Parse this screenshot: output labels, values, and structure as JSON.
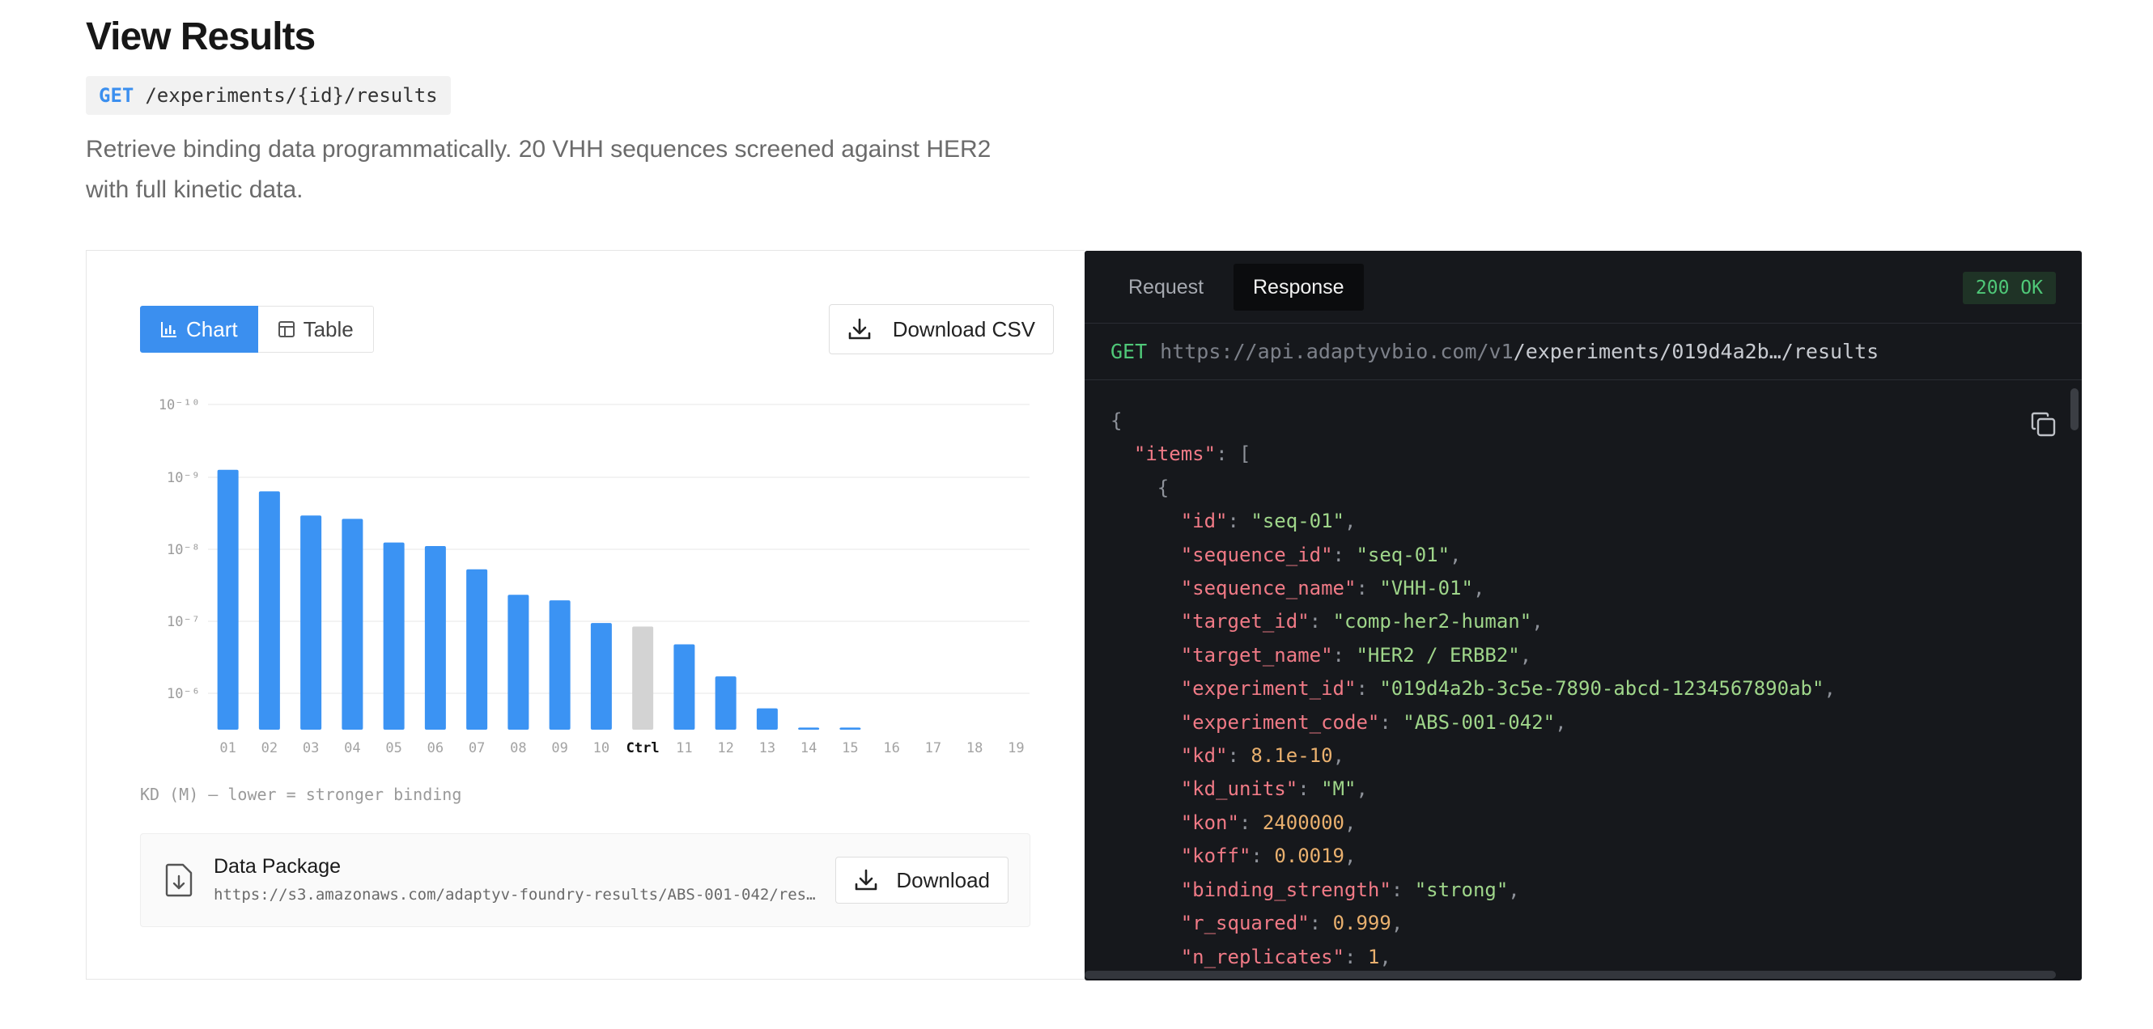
{
  "page": {
    "title": "View Results",
    "endpoint_method": "GET",
    "endpoint_path": "/experiments/{id}/results",
    "description": "Retrieve binding data programmatically. 20 VHH sequences screened against HER2 with full kinetic data."
  },
  "toolbar": {
    "chart_label": "Chart",
    "table_label": "Table",
    "download_csv_label": "Download CSV"
  },
  "chart_data": {
    "type": "bar",
    "title": "",
    "xlabel": "",
    "ylabel": "",
    "y_scale": "log",
    "y_ticks": [
      "10⁻¹⁰",
      "10⁻⁹",
      "10⁻⁸",
      "10⁻⁷",
      "10⁻⁶"
    ],
    "categories": [
      "01",
      "02",
      "03",
      "04",
      "05",
      "06",
      "07",
      "08",
      "09",
      "10",
      "Ctrl",
      "11",
      "12",
      "13",
      "14",
      "15",
      "16",
      "17",
      "18",
      "19"
    ],
    "values": [
      8.1e-10,
      1.5e-09,
      3e-09,
      3.3e-09,
      6.5e-09,
      7.2e-09,
      1.4e-08,
      2.9e-08,
      3.4e-08,
      6.5e-08,
      7.2e-08,
      1.2e-07,
      3e-07,
      7.5e-07,
      1.3e-06,
      1.3e-06,
      null,
      null,
      null,
      null
    ],
    "highlight_category": "Ctrl",
    "grid": true,
    "bar_color": "#3b93f3",
    "control_color": "#d3d3d3"
  },
  "chart_caption": "KD (M) — lower = stronger binding",
  "data_package": {
    "title": "Data Package",
    "url": "https://s3.amazonaws.com/adaptyv-foundry-results/ABS-001-042/results.zip",
    "download_label": "Download"
  },
  "response_panel": {
    "tab_request": "Request",
    "tab_response": "Response",
    "status": "200 OK",
    "url_method": "GET",
    "url_base": "https://api.adaptyvbio.com/v1",
    "url_path": "/experiments/019d4a2b…/results",
    "code": [
      {
        "indent": 0,
        "text": "{"
      },
      {
        "indent": 1,
        "key": "items",
        "open": "["
      },
      {
        "indent": 2,
        "text": "{"
      },
      {
        "indent": 3,
        "key": "id",
        "value": "seq-01",
        "vtype": "s"
      },
      {
        "indent": 3,
        "key": "sequence_id",
        "value": "seq-01",
        "vtype": "s"
      },
      {
        "indent": 3,
        "key": "sequence_name",
        "value": "VHH-01",
        "vtype": "s"
      },
      {
        "indent": 3,
        "key": "target_id",
        "value": "comp-her2-human",
        "vtype": "s"
      },
      {
        "indent": 3,
        "key": "target_name",
        "value": "HER2 / ERBB2",
        "vtype": "s"
      },
      {
        "indent": 3,
        "key": "experiment_id",
        "value": "019d4a2b-3c5e-7890-abcd-1234567890ab",
        "vtype": "s"
      },
      {
        "indent": 3,
        "key": "experiment_code",
        "value": "ABS-001-042",
        "vtype": "s"
      },
      {
        "indent": 3,
        "key": "kd",
        "value": "8.1e-10",
        "vtype": "n"
      },
      {
        "indent": 3,
        "key": "kd_units",
        "value": "M",
        "vtype": "s"
      },
      {
        "indent": 3,
        "key": "kon",
        "value": "2400000",
        "vtype": "n"
      },
      {
        "indent": 3,
        "key": "koff",
        "value": "0.0019",
        "vtype": "n"
      },
      {
        "indent": 3,
        "key": "binding_strength",
        "value": "strong",
        "vtype": "s"
      },
      {
        "indent": 3,
        "key": "r_squared",
        "value": "0.999",
        "vtype": "n"
      },
      {
        "indent": 3,
        "key": "n_replicates",
        "value": "1",
        "vtype": "n"
      }
    ]
  }
}
